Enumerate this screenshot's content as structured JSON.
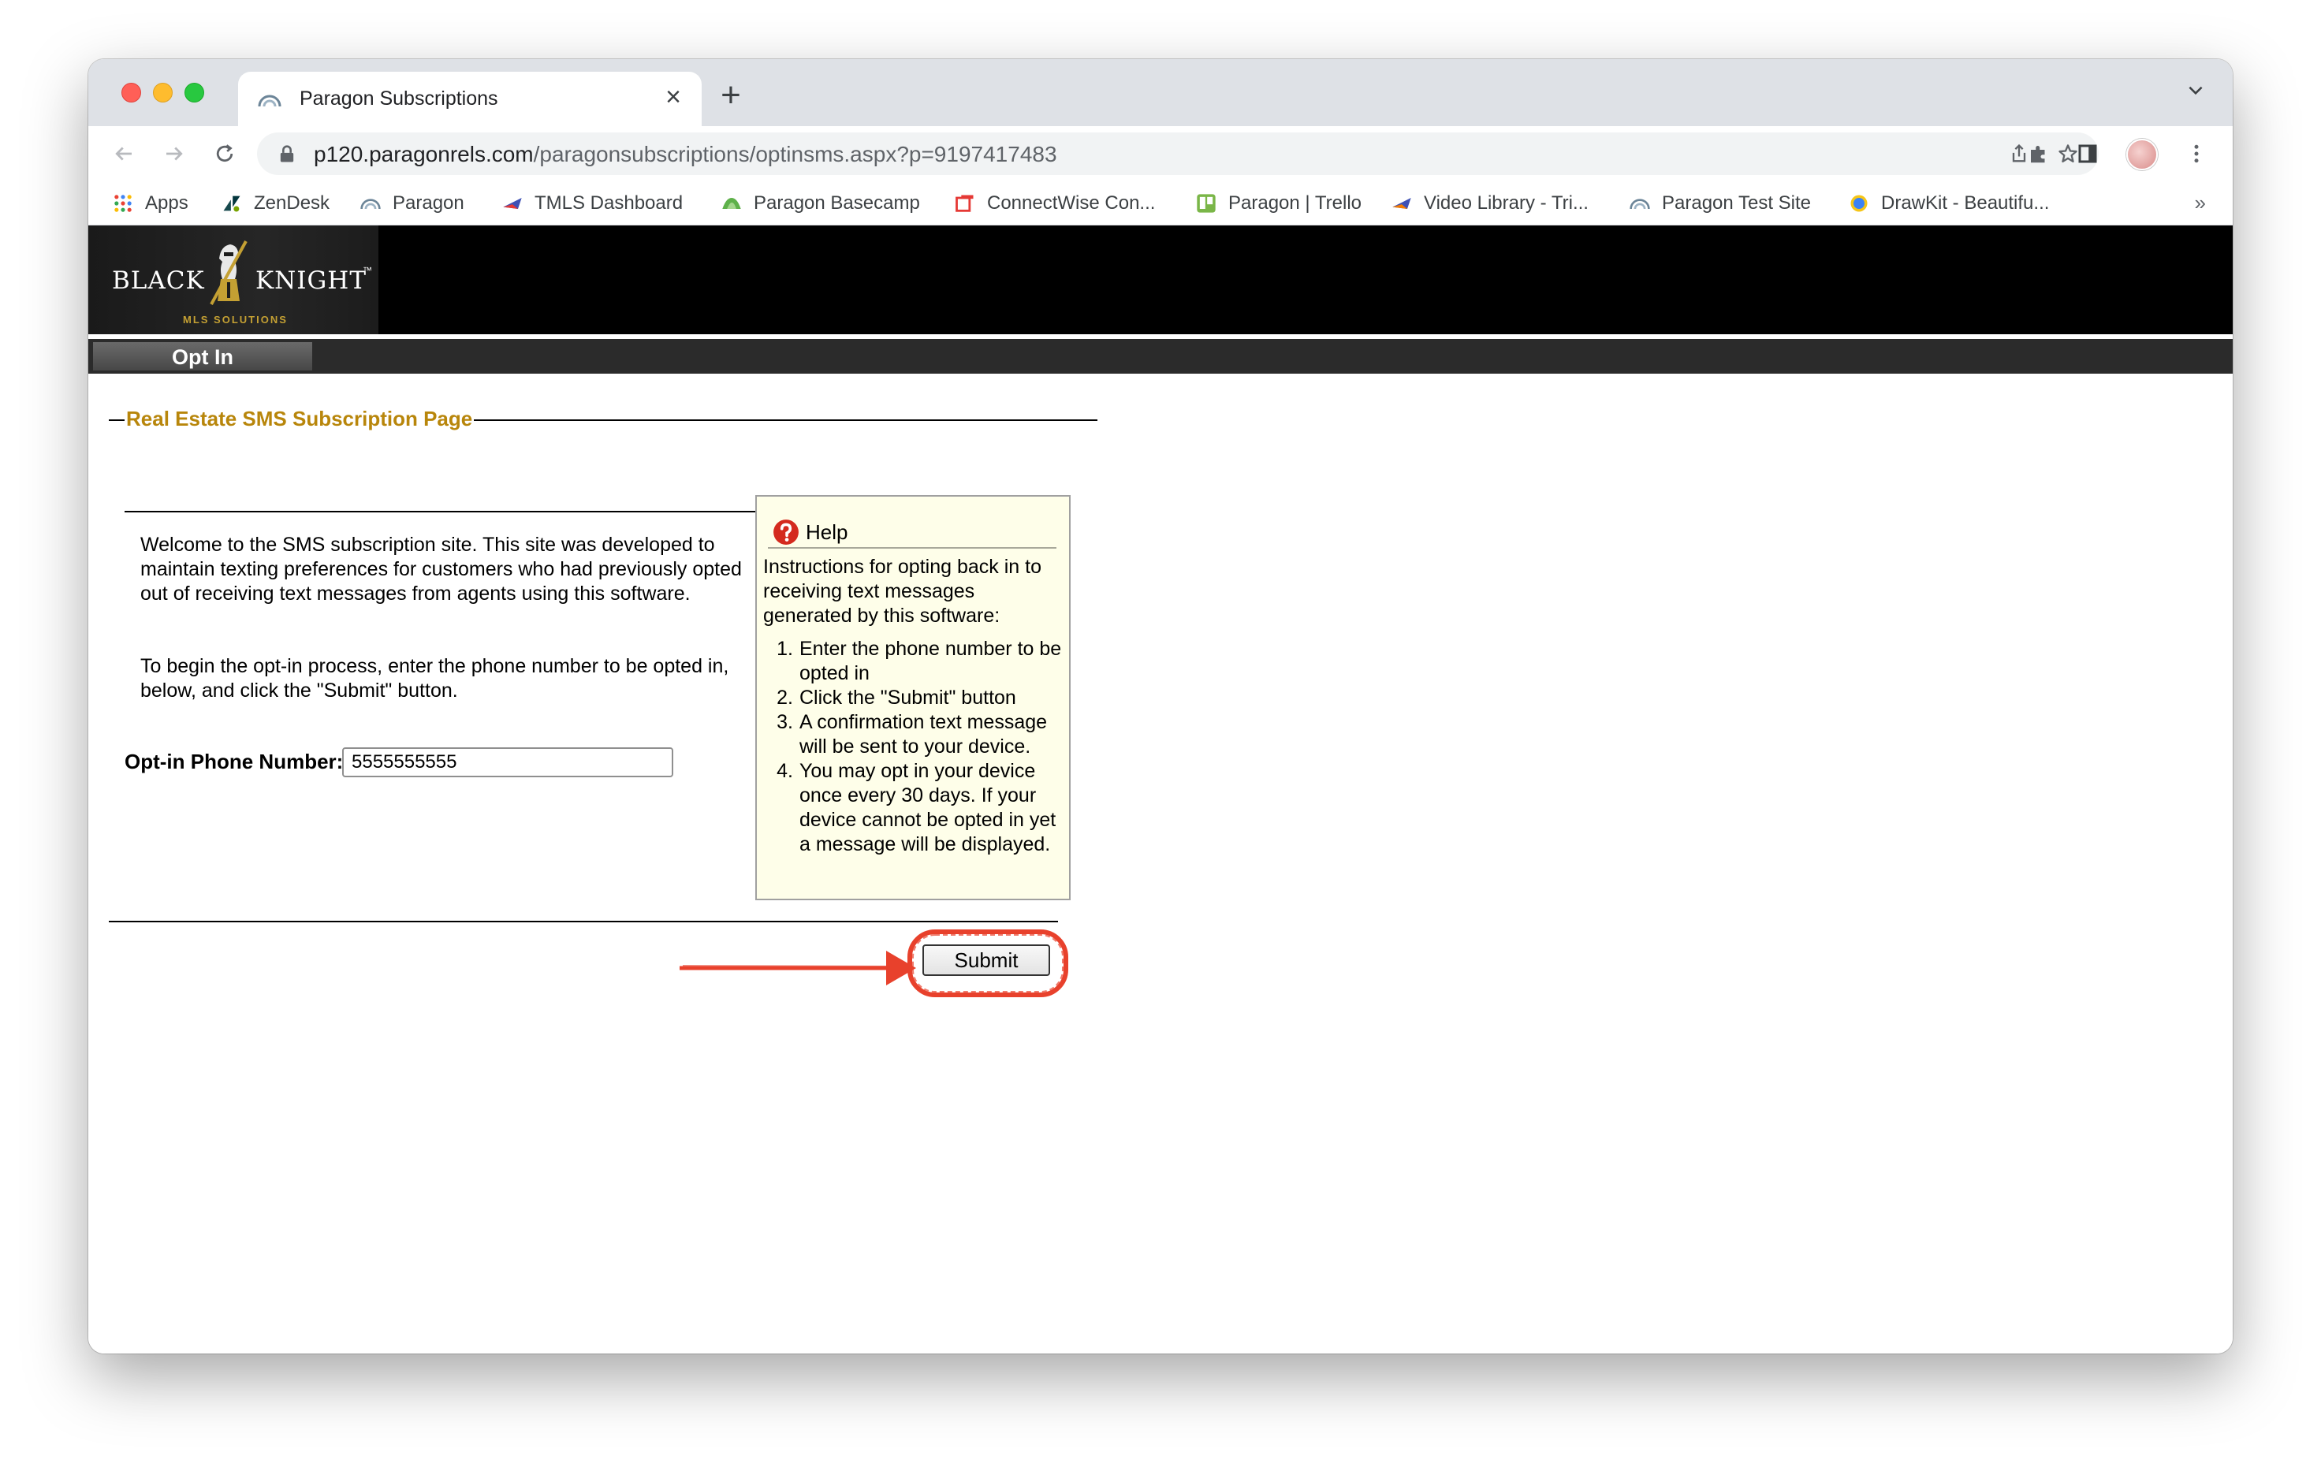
{
  "browser": {
    "tab_title": "Paragon Subscriptions",
    "tab_close": "×",
    "new_tab": "+",
    "url_host": "p120.paragonrels.com",
    "url_path": "/paragonsubscriptions/optinsms.aspx?p=9197417483",
    "bookmarks": [
      "Apps",
      "ZenDesk",
      "Paragon",
      "TMLS Dashboard",
      "Paragon Basecamp",
      "ConnectWise Con...",
      "Paragon | Trello",
      "Video Library - Tri...",
      "Paragon Test Site",
      "DrawKit - Beautifu..."
    ],
    "bookmarks_more": "»"
  },
  "site": {
    "logo_left": "BLACK",
    "logo_right": "KNIGHT",
    "logo_tm": "™",
    "logo_sub": "MLS SOLUTIONS",
    "tab_label": "Opt In"
  },
  "form": {
    "legend": "Real Estate SMS Subscription Page",
    "welcome_text": "Welcome to the SMS subscription site. This site was developed to maintain texting preferences for customers who had previously opted out of receiving text messages from agents using this software.",
    "begin_text": "To begin the opt-in process, enter the phone number to be opted in, below, and click the \"Submit\" button.",
    "phone_label": "Opt-in Phone Number:",
    "phone_value": "5555555555",
    "submit_label": "Submit"
  },
  "help": {
    "title": "Help",
    "intro": "Instructions for opting back in to receiving text messages generated by this software:",
    "steps": [
      {
        "num": "1.",
        "text": "Enter the phone number to be opted in"
      },
      {
        "num": "2.",
        "text": "Click the \"Submit\" button"
      },
      {
        "num": "3.",
        "text": "A confirmation text message will be sent to your device."
      },
      {
        "num": "4.",
        "text": "You may opt in your device once every 30 days. If your device cannot be opted in yet a message will be displayed."
      }
    ]
  },
  "colors": {
    "legend": "#b8860b",
    "annotation": "#e8412c",
    "help_bg": "#fefee9"
  }
}
